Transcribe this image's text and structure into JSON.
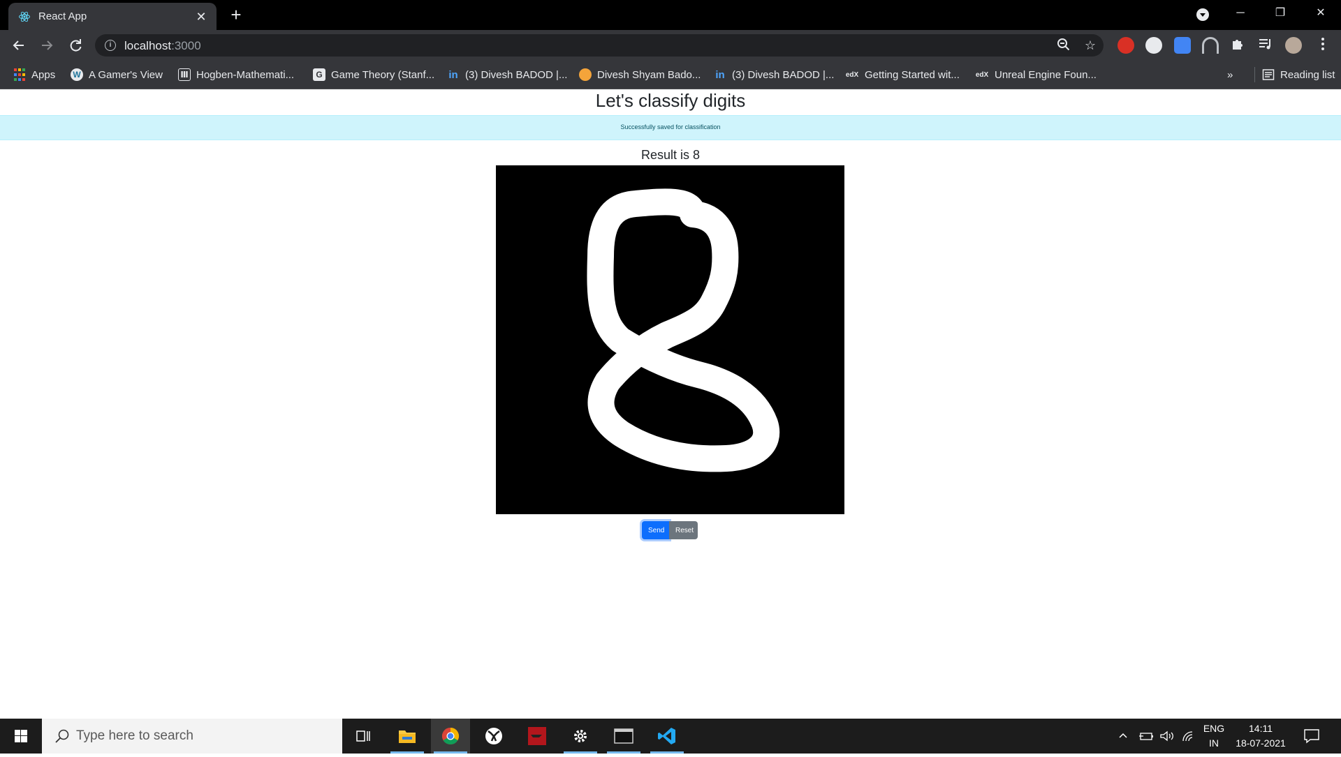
{
  "browser": {
    "tab_title": "React App",
    "url_host": "localhost",
    "url_port": ":3000",
    "tab_close": "✕",
    "new_tab": "+",
    "window_controls": [
      "─",
      "❐",
      "✕"
    ]
  },
  "bookmarks": [
    {
      "label": "Apps",
      "icon": "apps-grid-icon"
    },
    {
      "label": "A Gamer's View",
      "icon": "wordpress-icon"
    },
    {
      "label": "Hogben-Mathemati...",
      "icon": "library-icon"
    },
    {
      "label": "Game Theory (Stanf...",
      "icon": "game-theory-icon"
    },
    {
      "label": "(3) Divesh BADOD |...",
      "icon": "linkedin-icon"
    },
    {
      "label": "Divesh Shyam Bado...",
      "icon": "profile-orange-icon"
    },
    {
      "label": "(3) Divesh BADOD |...",
      "icon": "linkedin-icon"
    },
    {
      "label": "Getting Started wit...",
      "icon": "edx-icon"
    },
    {
      "label": "Unreal Engine Foun...",
      "icon": "edx-icon"
    }
  ],
  "bookmarks_overflow": "»",
  "reading_list": "Reading list",
  "page": {
    "title": "Let's classify digits",
    "alert": "Successfully saved for classification",
    "result": "Result is 8",
    "send_label": "Send",
    "reset_label": "Reset"
  },
  "taskbar": {
    "search_placeholder": "Type here to search",
    "lang_line1": "ENG",
    "lang_line2": "IN",
    "time": "14:11",
    "date": "18-07-2021"
  },
  "colors": {
    "alert_bg": "#cff4fc",
    "send_btn": "#0d6efd",
    "reset_btn": "#6c757d",
    "tab_bg": "#35363a"
  }
}
